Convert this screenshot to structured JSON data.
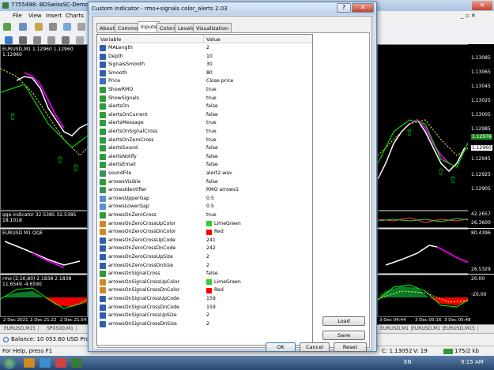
{
  "mt4": {
    "title": "7755498: BDSwissSC-Demo01 - D",
    "menu": [
      "File",
      "View",
      "Insert",
      "Charts"
    ],
    "chart_top_label": "EURUSD,M1 1.12960 1.12960 1.12960",
    "qqe_label": "qqe-indicator 32.5385 32.5385 18.1018",
    "qqe2_label": "EURUSD M1 QQE",
    "rmo_label": "rmo (2,10,80) 2.1838 2.1838 11.6549 -4.6590",
    "date_labels": [
      "2 Dec 2021",
      "2 Dec 21:22",
      "2 Dec 21:54",
      "3 Dec 04:44",
      "3 Dec 05:16",
      "3 Dec 05:48"
    ],
    "prices_top": [
      "1.13085",
      "1.13065",
      "1.13045",
      "1.13025",
      "1.13005",
      "1.12985",
      "1.12960",
      "1.12945",
      "1.12925",
      "1.12905"
    ],
    "price_highlight": "1.12976",
    "price_highlight2": "1.12960",
    "qqe_axis": [
      "42.2657",
      "26.3600"
    ],
    "qqe2_axis": [
      "80.4396",
      "26.5329"
    ],
    "rmo_axis": [
      "20.00",
      "-20.00"
    ],
    "symbol_tabs": [
      "EURUSD,M15",
      "SPX500,M1",
      "EURUSD,M1",
      "EURUSD,M1",
      "EURUSD,M15"
    ],
    "terminal_text": "Balance: 10 053.60 USD  Profit/Lo",
    "status_left": "For Help, press F1",
    "status_mid": "C: 1.13052",
    "status_v": "V: 19",
    "status_kb": "175/2 kb",
    "taskbar_lang": "EN",
    "taskbar_time": "9:15 AM"
  },
  "dialog": {
    "title": "Custom Indicator - rmo+signals color_alerts 2.03",
    "tabs": [
      "About",
      "Common",
      "Inputs",
      "Colors",
      "Levels",
      "Visualization"
    ],
    "active_tab": "Inputs",
    "col_variable": "Variable",
    "col_value": "Value",
    "rows": [
      {
        "icon": "num",
        "name": "MALength",
        "value": "2"
      },
      {
        "icon": "num",
        "name": "Depth",
        "value": "10"
      },
      {
        "icon": "num",
        "name": "SignalsSmooth",
        "value": "30"
      },
      {
        "icon": "num",
        "name": "Smooth",
        "value": "80"
      },
      {
        "icon": "list",
        "name": "Price",
        "value": "Close price"
      },
      {
        "icon": "bool",
        "name": "ShowRMO",
        "value": "true"
      },
      {
        "icon": "bool",
        "name": "ShowSignals",
        "value": "true"
      },
      {
        "icon": "bool",
        "name": "alertsOn",
        "value": "false"
      },
      {
        "icon": "bool",
        "name": "alertsOnCurrent",
        "value": "false"
      },
      {
        "icon": "bool",
        "name": "alertsMessage",
        "value": "true"
      },
      {
        "icon": "bool",
        "name": "alertsOnSignalCross",
        "value": "true"
      },
      {
        "icon": "bool",
        "name": "alertsOnZeroCross",
        "value": "true"
      },
      {
        "icon": "bool",
        "name": "alertsSound",
        "value": "false"
      },
      {
        "icon": "bool",
        "name": "alertsNotify",
        "value": "false"
      },
      {
        "icon": "bool",
        "name": "alertsEmail",
        "value": "false"
      },
      {
        "icon": "str",
        "name": "soundFile",
        "value": "alert2.wav"
      },
      {
        "icon": "bool",
        "name": "arrowsVisible",
        "value": "false"
      },
      {
        "icon": "str",
        "name": "arrowsIdentifier",
        "value": "RMO arrows1"
      },
      {
        "icon": "dbl",
        "name": "arrowsUpperGap",
        "value": "0.5"
      },
      {
        "icon": "dbl",
        "name": "arrowsLowerGap",
        "value": "0.5"
      },
      {
        "icon": "bool",
        "name": "arrowsOnZeroCross",
        "value": "true"
      },
      {
        "icon": "col",
        "name": "arrowsOnZeroCrossUpColor",
        "value": "LimeGreen",
        "swatch": "#32cd32"
      },
      {
        "icon": "col",
        "name": "arrowsOnZeroCrossDnColor",
        "value": "Red",
        "swatch": "#ff0000"
      },
      {
        "icon": "num",
        "name": "arrowsOnZeroCrossUpCode",
        "value": "241"
      },
      {
        "icon": "num",
        "name": "arrowsOnZeroCrossDnCode",
        "value": "242"
      },
      {
        "icon": "num",
        "name": "arrowsOnZeroCrossUpSize",
        "value": "2"
      },
      {
        "icon": "num",
        "name": "arrowsOnZeroCrossDnSize",
        "value": "2"
      },
      {
        "icon": "bool",
        "name": "arrowsOnSignalCross",
        "value": "false"
      },
      {
        "icon": "col",
        "name": "arrowsOnSignalCrossUpColor",
        "value": "LimeGreen",
        "swatch": "#32cd32"
      },
      {
        "icon": "col",
        "name": "arrowsOnSignalCrossDnColor",
        "value": "Red",
        "swatch": "#ff0000"
      },
      {
        "icon": "num",
        "name": "arrowsOnSignalCrossUpCode",
        "value": "159"
      },
      {
        "icon": "num",
        "name": "arrowsOnSignalCrossDnCode",
        "value": "159"
      },
      {
        "icon": "num",
        "name": "arrowsOnSignalCrossUpSize",
        "value": "2"
      },
      {
        "icon": "num",
        "name": "arrowsOnSignalCrossDnSize",
        "value": "2"
      }
    ],
    "load_label": "Load",
    "save_label": "Save",
    "ok_label": "OK",
    "cancel_label": "Cancel",
    "reset_label": "Reset"
  }
}
